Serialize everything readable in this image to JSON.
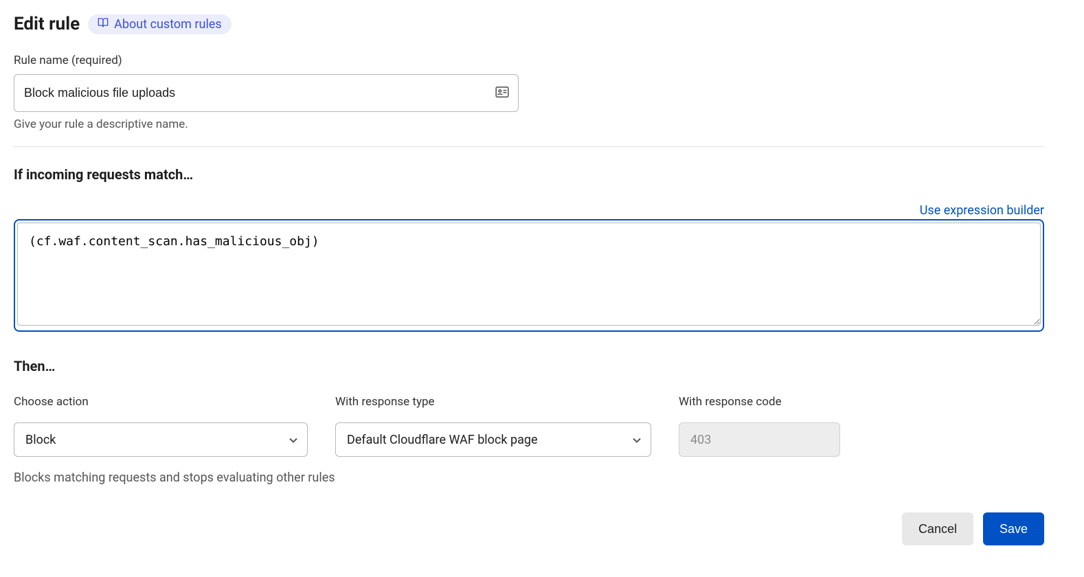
{
  "header": {
    "title": "Edit rule",
    "about_link": "About custom rules"
  },
  "rule_name": {
    "label": "Rule name (required)",
    "value": "Block malicious file uploads",
    "helper": "Give your rule a descriptive name."
  },
  "match": {
    "heading": "If incoming requests match…",
    "builder_link": "Use expression builder",
    "expression": "(cf.waf.content_scan.has_malicious_obj)"
  },
  "then": {
    "heading": "Then…",
    "action_label": "Choose action",
    "action_value": "Block",
    "response_type_label": "With response type",
    "response_type_value": "Default Cloudflare WAF block page",
    "response_code_label": "With response code",
    "response_code_value": "403",
    "description": "Blocks matching requests and stops evaluating other rules"
  },
  "footer": {
    "cancel": "Cancel",
    "save": "Save"
  }
}
